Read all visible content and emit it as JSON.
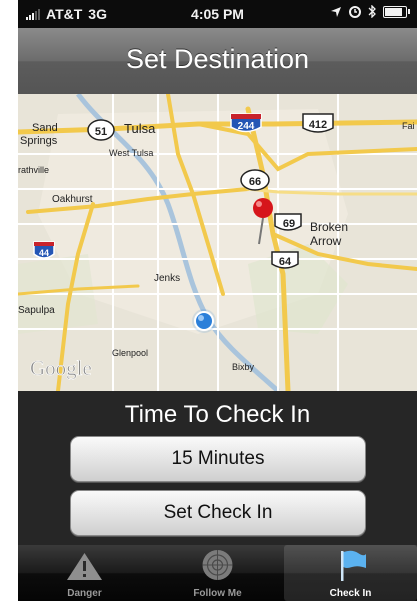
{
  "status_bar": {
    "carrier": "AT&T",
    "network": "3G",
    "time": "4:05 PM"
  },
  "nav": {
    "title": "Set Destination"
  },
  "map": {
    "labels": {
      "sand_springs_1": "Sand",
      "sand_springs_2": "Springs",
      "tulsa": "Tulsa",
      "west_tulsa": "West Tulsa",
      "sapulpa_partial": "rathville",
      "oakhurst": "Oakhurst",
      "broken_arrow_1": "Broken",
      "broken_arrow_2": "Arrow",
      "jenks": "Jenks",
      "sapulpa": "Sapulpa",
      "glenpool": "Glenpool",
      "bixby": "Bixby",
      "far_right": "Fai",
      "google": "Google"
    },
    "shields": {
      "hwy_51": "51",
      "hwy_244": "244",
      "hwy_412": "412",
      "hwy_66": "66",
      "hwy_69": "69",
      "hwy_64": "64",
      "hwy_44": "44"
    },
    "colors": {
      "pin": "#d6151b",
      "location": "#2b7fd9"
    }
  },
  "checkin": {
    "heading": "Time To Check In",
    "duration_label": "15 Minutes",
    "set_label": "Set Check In"
  },
  "tabs": {
    "danger": "Danger",
    "follow_me": "Follow Me",
    "check_in": "Check In"
  }
}
